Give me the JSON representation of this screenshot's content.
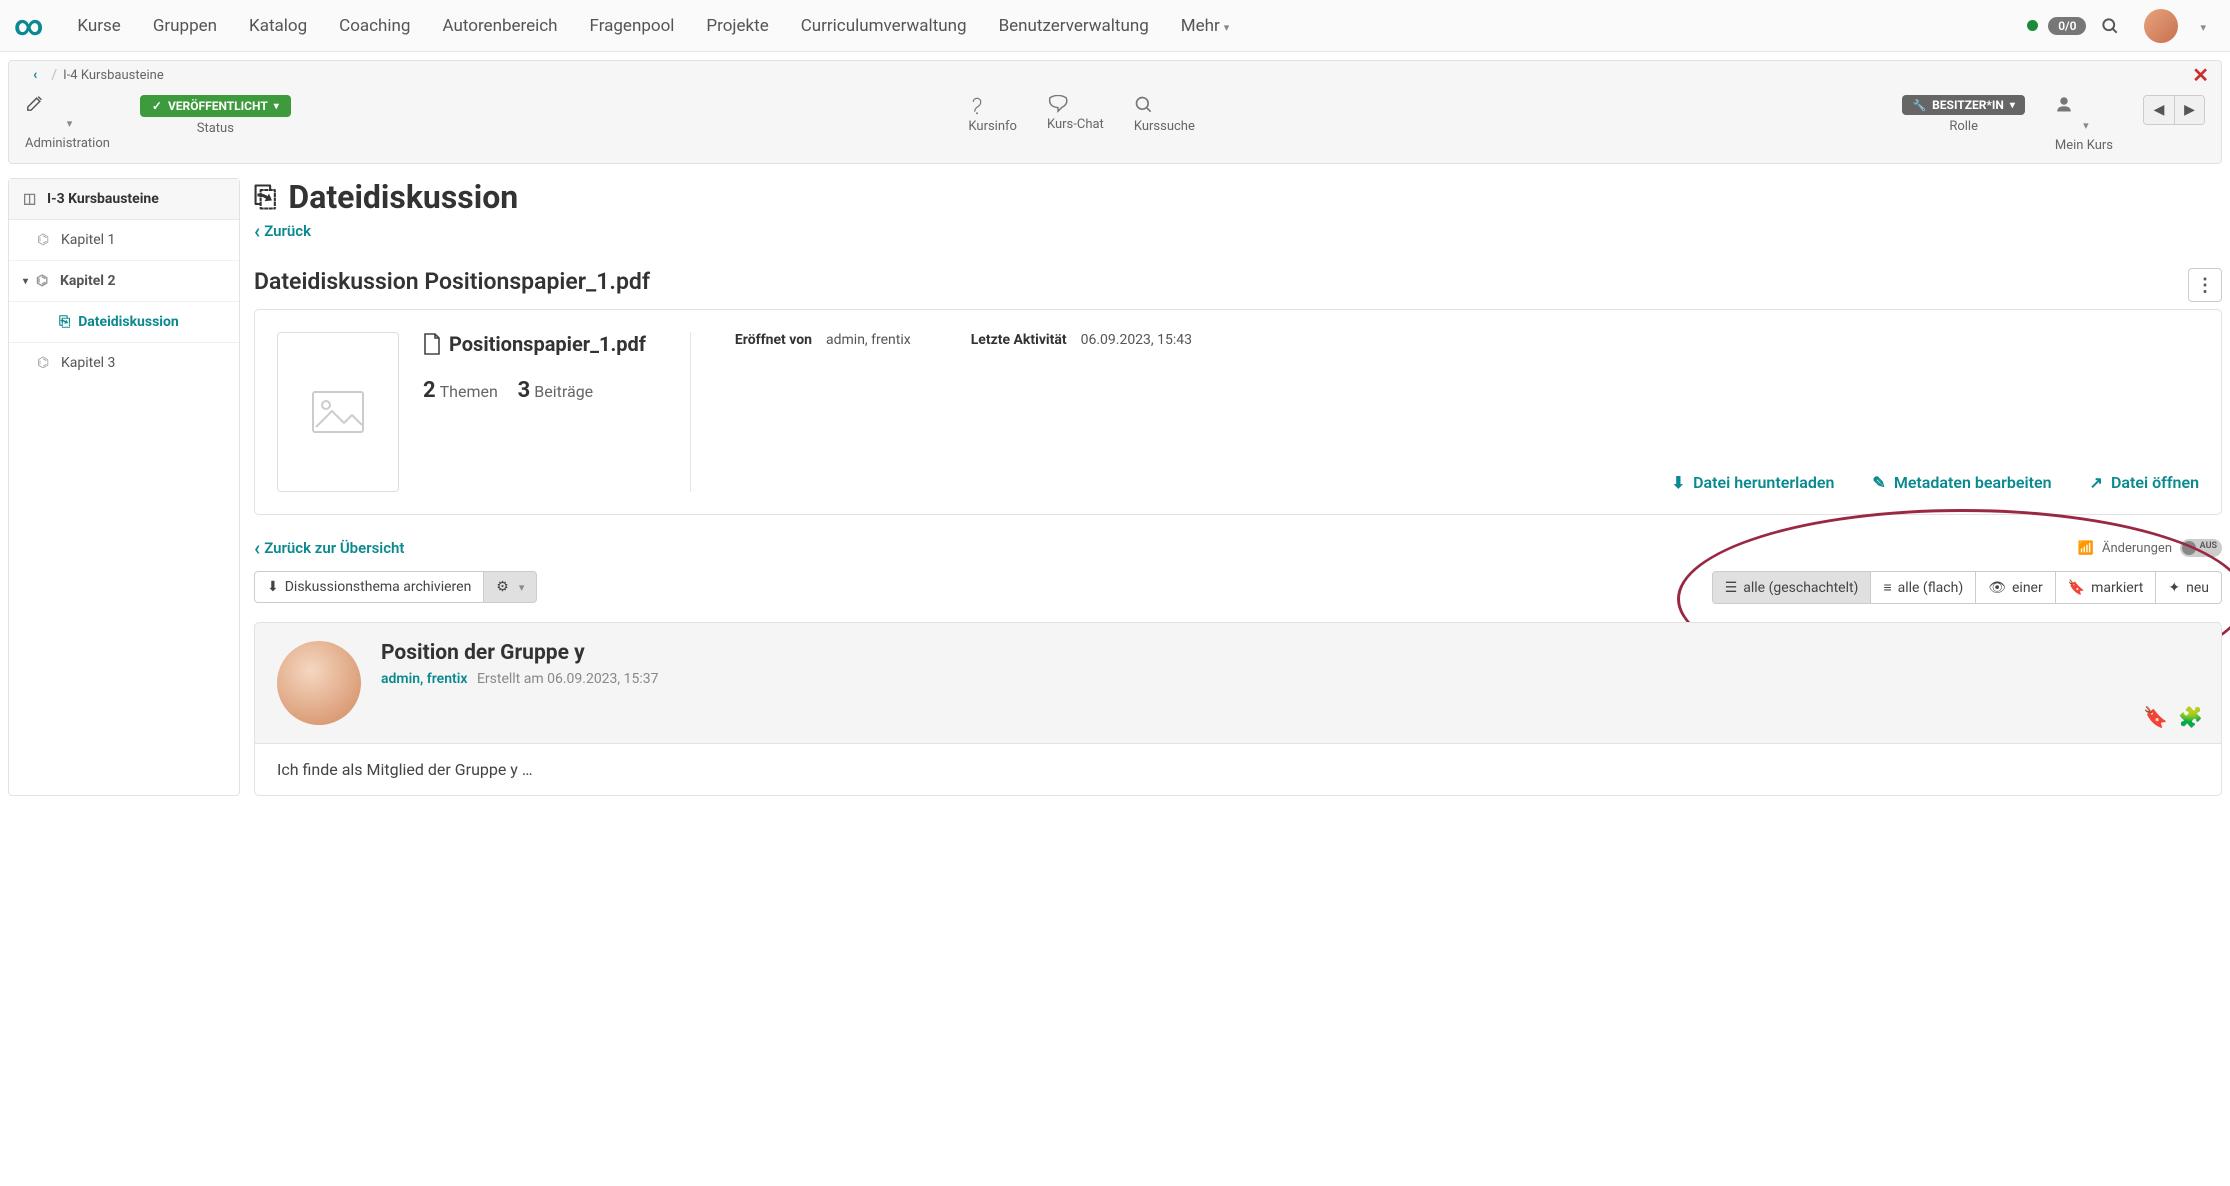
{
  "nav": {
    "items": [
      "Kurse",
      "Gruppen",
      "Katalog",
      "Coaching",
      "Autorenbereich",
      "Fragenpool",
      "Projekte",
      "Curriculumverwaltung",
      "Benutzerverwaltung",
      "Mehr"
    ],
    "badge": "0/0"
  },
  "crumb": {
    "back": "‹",
    "text": "I-4 Kursbausteine",
    "close": "✕"
  },
  "toolbar": {
    "admin": "Administration",
    "status_pill": "VERÖFFENTLICHT",
    "status_label": "Status",
    "kursinfo": "Kursinfo",
    "kurschat": "Kurs-Chat",
    "kurssuche": "Kurssuche",
    "role_pill": "BESITZER*IN",
    "role_label": "Rolle",
    "meinkurs": "Mein Kurs"
  },
  "sidebar": {
    "header": "I-3 Kursbausteine",
    "kap1": "Kapitel 1",
    "kap2": "Kapitel 2",
    "sub": "Dateidiskussion",
    "kap3": "Kapitel 3"
  },
  "page": {
    "title": "Dateidiskussion",
    "back": "Zurück",
    "subheading": "Dateidiskussion Positionspapier_1.pdf"
  },
  "file": {
    "name": "Positionspapier_1.pdf",
    "themen_count": "2",
    "themen_label": "Themen",
    "beitraege_count": "3",
    "beitraege_label": "Beiträge"
  },
  "meta": {
    "opened_k": "Eröffnet von",
    "opened_v": "admin, frentix",
    "activity_k": "Letzte Aktivität",
    "activity_v": "06.09.2023, 15:43"
  },
  "actions": {
    "download": "Datei herunterladen",
    "edit": "Metadaten bearbeiten",
    "open": "Datei öffnen"
  },
  "overview_back": "Zurück zur Übersicht",
  "rss": {
    "label": "Änderungen",
    "switch": "AUS"
  },
  "tb2": {
    "archive": "Diskussionsthema archivieren",
    "gear": "⚙",
    "v1": "alle (geschachtelt)",
    "v2": "alle (flach)",
    "v3": "einer",
    "v4": "markiert",
    "v5": "neu"
  },
  "post": {
    "title": "Position der Gruppe y",
    "author": "admin, frentix",
    "date": "Erstellt am 06.09.2023, 15:37",
    "body": "Ich finde als Mitglied der Gruppe y …"
  }
}
